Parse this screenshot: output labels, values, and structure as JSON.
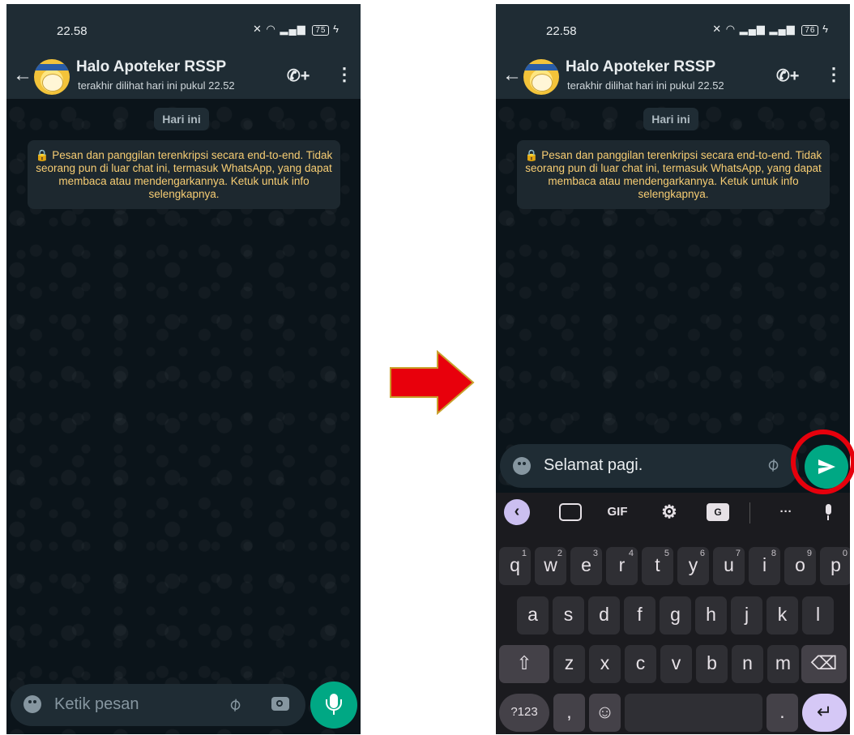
{
  "left_screen": {
    "status": {
      "time": "22.58",
      "battery": "75"
    },
    "header": {
      "name": "Halo Apoteker RSSP",
      "last_seen": "terakhir dilihat hari ini pukul 22.52"
    },
    "date_chip": "Hari ini",
    "encryption_notice": "🔒 Pesan dan panggilan terenkripsi secara end-to-end. Tidak seorang pun di luar chat ini, termasuk WhatsApp, yang dapat membaca atau mendengarkannya. Ketuk untuk info selengkapnya.",
    "composer": {
      "placeholder": "Ketik pesan"
    }
  },
  "right_screen": {
    "status": {
      "time": "22.58",
      "battery": "76"
    },
    "header": {
      "name": "Halo Apoteker RSSP",
      "last_seen": "terakhir dilihat hari ini pukul 22.52"
    },
    "date_chip": "Hari ini",
    "encryption_notice": "🔒 Pesan dan panggilan terenkripsi secara end-to-end. Tidak seorang pun di luar chat ini, termasuk WhatsApp, yang dapat membaca atau mendengarkannya. Ketuk untuk info selengkapnya.",
    "composer": {
      "text": "Selamat pagi."
    },
    "keyboard": {
      "toolbar": {
        "gif": "GIF",
        "more": "···",
        "translate": "G"
      },
      "row1": [
        {
          "k": "q",
          "n": "1"
        },
        {
          "k": "w",
          "n": "2"
        },
        {
          "k": "e",
          "n": "3"
        },
        {
          "k": "r",
          "n": "4"
        },
        {
          "k": "t",
          "n": "5"
        },
        {
          "k": "y",
          "n": "6"
        },
        {
          "k": "u",
          "n": "7"
        },
        {
          "k": "i",
          "n": "8"
        },
        {
          "k": "o",
          "n": "9"
        },
        {
          "k": "p",
          "n": "0"
        }
      ],
      "row2": [
        "a",
        "s",
        "d",
        "f",
        "g",
        "h",
        "j",
        "k",
        "l"
      ],
      "row3": [
        "z",
        "x",
        "c",
        "v",
        "b",
        "n",
        "m"
      ],
      "symbols_key": "?123",
      "comma_key": ",",
      "period_key": "."
    }
  },
  "colors": {
    "accent_green": "#00a884",
    "highlight_red": "#e6000c",
    "arrow_red": "#e8000c",
    "arrow_outline": "#c8a02c"
  },
  "icons": [
    "back-arrow-icon",
    "add-call-icon",
    "more-vert-icon",
    "emoji-icon",
    "attach-icon",
    "camera-icon",
    "mic-icon",
    "send-icon",
    "shift-icon",
    "backspace-icon",
    "enter-icon"
  ]
}
